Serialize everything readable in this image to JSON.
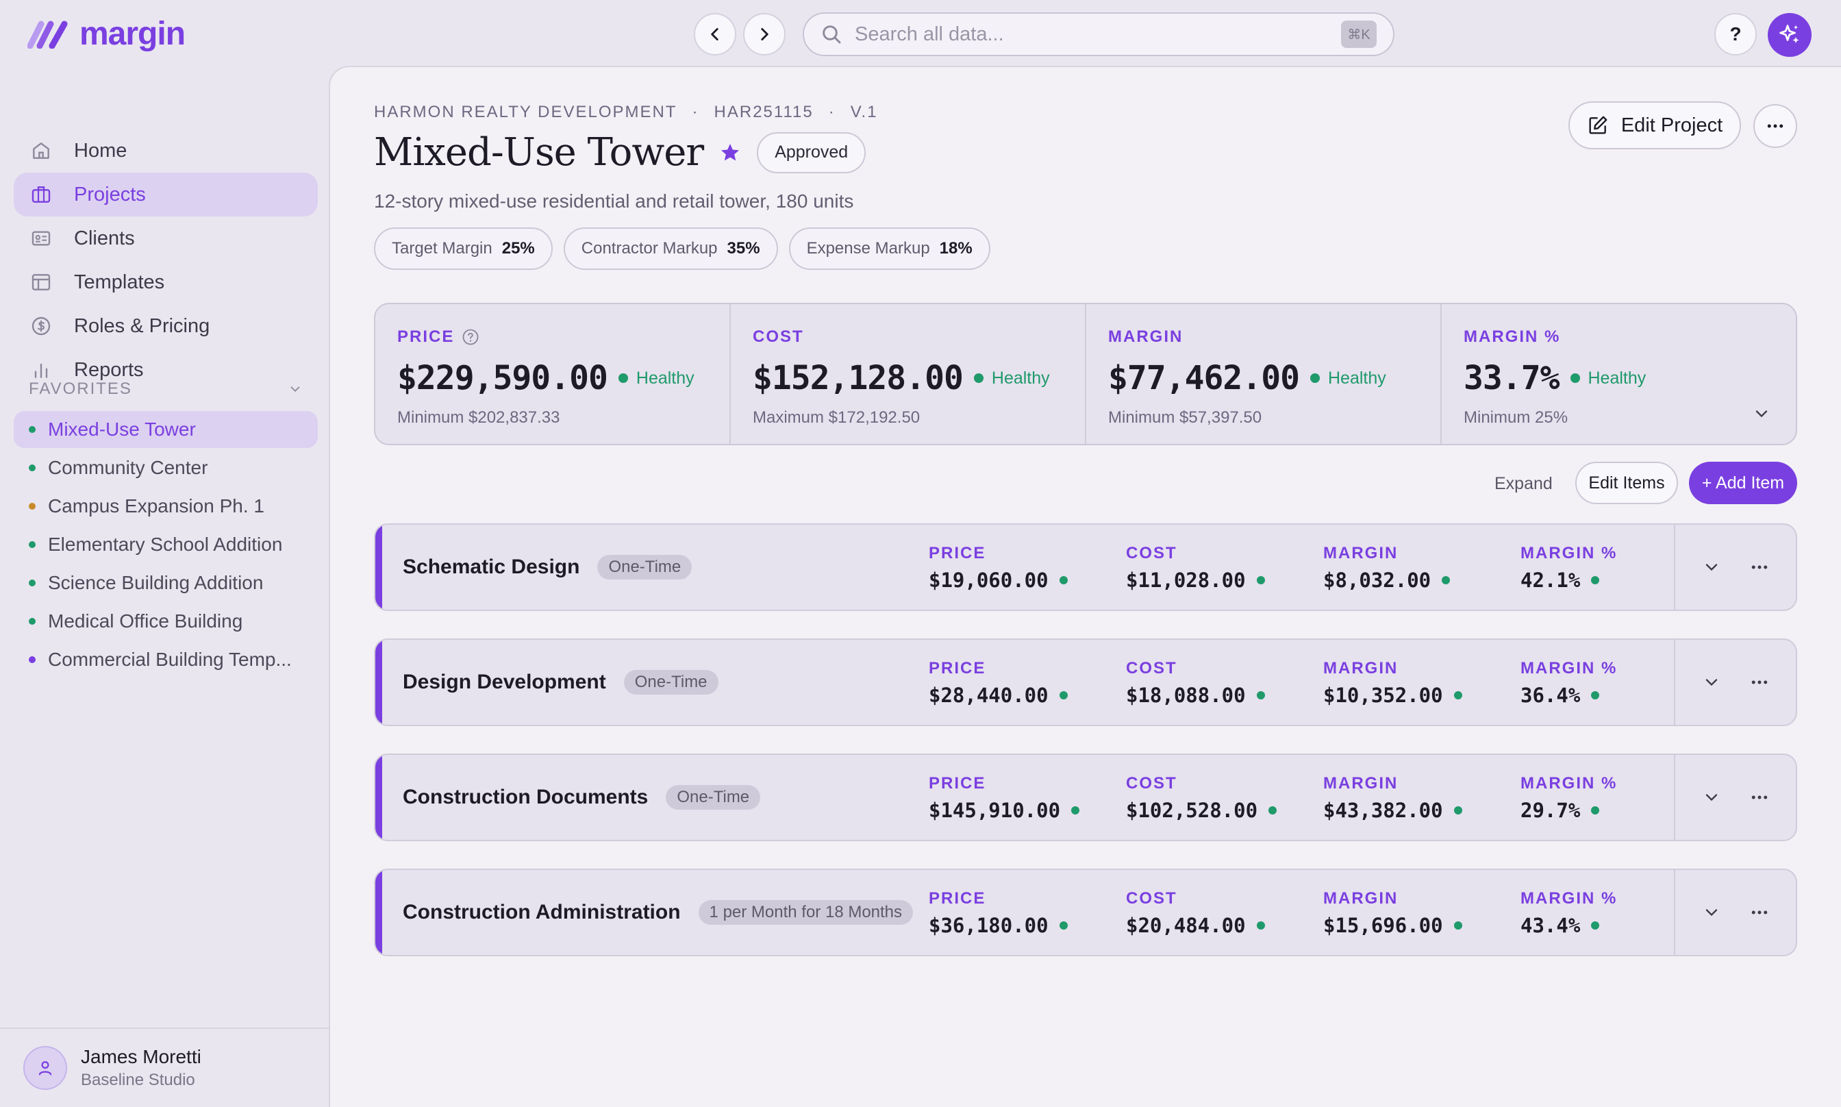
{
  "app": {
    "name": "margin",
    "brand_color": "#7a3fe0",
    "healthy_color": "#1f9a6a"
  },
  "search": {
    "placeholder": "Search all data...",
    "shortcut": "⌘K"
  },
  "help_label": "?",
  "sidebar": {
    "nav": [
      {
        "label": "Home",
        "icon": "home-icon",
        "active": false
      },
      {
        "label": "Projects",
        "icon": "briefcase-icon",
        "active": true
      },
      {
        "label": "Clients",
        "icon": "id-card-icon",
        "active": false
      },
      {
        "label": "Templates",
        "icon": "layout-icon",
        "active": false
      },
      {
        "label": "Roles & Pricing",
        "icon": "dollar-circle-icon",
        "active": false
      },
      {
        "label": "Reports",
        "icon": "bar-chart-icon",
        "active": false
      }
    ],
    "favorites_title": "FAVORITES",
    "favorites": [
      {
        "label": "Mixed-Use Tower",
        "color": "#1f9a6a",
        "active": true
      },
      {
        "label": "Community Center",
        "color": "#1f9a6a",
        "active": false
      },
      {
        "label": "Campus Expansion Ph. 1",
        "color": "#c98a2b",
        "active": false
      },
      {
        "label": "Elementary School Addition",
        "color": "#1f9a6a",
        "active": false
      },
      {
        "label": "Science Building Addition",
        "color": "#1f9a6a",
        "active": false
      },
      {
        "label": "Medical Office Building",
        "color": "#1f9a6a",
        "active": false
      },
      {
        "label": "Commercial Building Temp...",
        "color": "#7a3fe0",
        "active": false
      }
    ],
    "user": {
      "name": "James Moretti",
      "org": "Baseline Studio"
    }
  },
  "project": {
    "client": "HARMON REALTY DEVELOPMENT",
    "code": "HAR251115",
    "version": "V.1",
    "title": "Mixed-Use Tower",
    "status": "Approved",
    "description": "12-story mixed-use residential and retail tower, 180 units",
    "chips": [
      {
        "label": "Target Margin",
        "value": "25%"
      },
      {
        "label": "Contractor Markup",
        "value": "35%"
      },
      {
        "label": "Expense Markup",
        "value": "18%"
      }
    ],
    "edit_label": "Edit Project"
  },
  "summary": [
    {
      "label": "PRICE",
      "value": "$229,590.00",
      "status": "Healthy",
      "foot": "Minimum $202,837.33"
    },
    {
      "label": "COST",
      "value": "$152,128.00",
      "status": "Healthy",
      "foot": "Maximum $172,192.50"
    },
    {
      "label": "MARGIN",
      "value": "$77,462.00",
      "status": "Healthy",
      "foot": "Minimum $57,397.50"
    },
    {
      "label": "MARGIN %",
      "value": "33.7%",
      "status": "Healthy",
      "foot": "Minimum 25%"
    }
  ],
  "actions": {
    "expand": "Expand",
    "edit_items": "Edit Items",
    "add_item": "+ Add Item"
  },
  "metric_labels": {
    "price": "PRICE",
    "cost": "COST",
    "margin": "MARGIN",
    "margin_pct": "MARGIN %"
  },
  "items": [
    {
      "name": "Schematic Design",
      "tag": "One-Time",
      "price": "$19,060.00",
      "cost": "$11,028.00",
      "margin": "$8,032.00",
      "margin_pct": "42.1%"
    },
    {
      "name": "Design Development",
      "tag": "One-Time",
      "price": "$28,440.00",
      "cost": "$18,088.00",
      "margin": "$10,352.00",
      "margin_pct": "36.4%"
    },
    {
      "name": "Construction Documents",
      "tag": "One-Time",
      "price": "$145,910.00",
      "cost": "$102,528.00",
      "margin": "$43,382.00",
      "margin_pct": "29.7%"
    },
    {
      "name": "Construction Administration",
      "tag": "1 per Month for 18 Months",
      "price": "$36,180.00",
      "cost": "$20,484.00",
      "margin": "$15,696.00",
      "margin_pct": "43.4%"
    }
  ]
}
